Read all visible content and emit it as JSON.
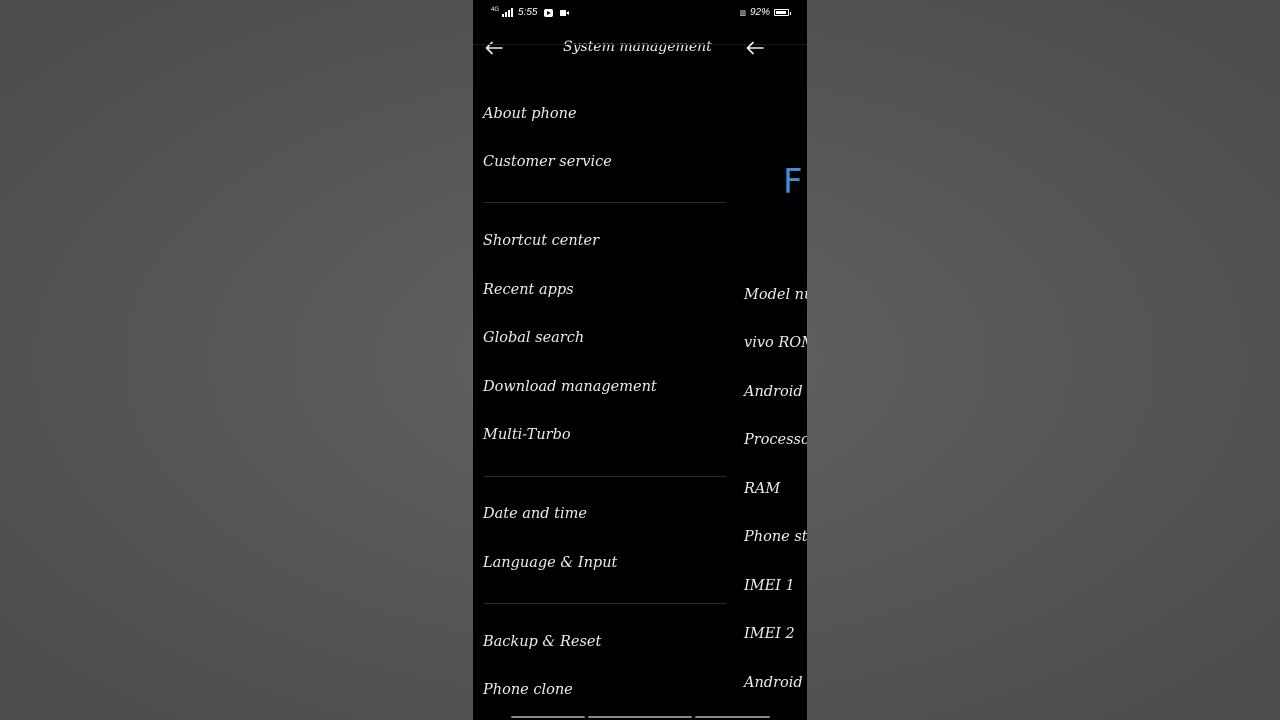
{
  "status_bar": {
    "time": "5:55",
    "network": "4G",
    "battery_percent": "92%",
    "battery_level": 0.92,
    "icons": [
      "signal-icon",
      "youtube-icon",
      "video-camera-icon",
      "volte-icon",
      "battery-icon"
    ]
  },
  "left_pane": {
    "title": "System management",
    "back_icon": "arrow-left-icon",
    "groups": [
      {
        "items": [
          "About phone",
          "Customer service"
        ]
      },
      {
        "items": [
          "Shortcut center",
          "Recent apps",
          "Global search",
          "Download management",
          "Multi-Turbo"
        ]
      },
      {
        "items": [
          "Date and time",
          "Language & Input"
        ]
      },
      {
        "items": [
          "Backup & Reset",
          "Phone clone"
        ]
      }
    ]
  },
  "right_pane": {
    "back_icon": "arrow-left-icon",
    "logo_text": "F",
    "items": [
      "Model nu",
      "vivo ROM",
      "Android v",
      "Processo",
      "RAM",
      "Phone sto",
      "IMEI 1",
      "IMEI 2",
      "Android s"
    ]
  },
  "colors": {
    "background": "#000000",
    "text": "#ededed",
    "logo_accent": "#3f8fd9",
    "divider": "#2a2a2a"
  }
}
